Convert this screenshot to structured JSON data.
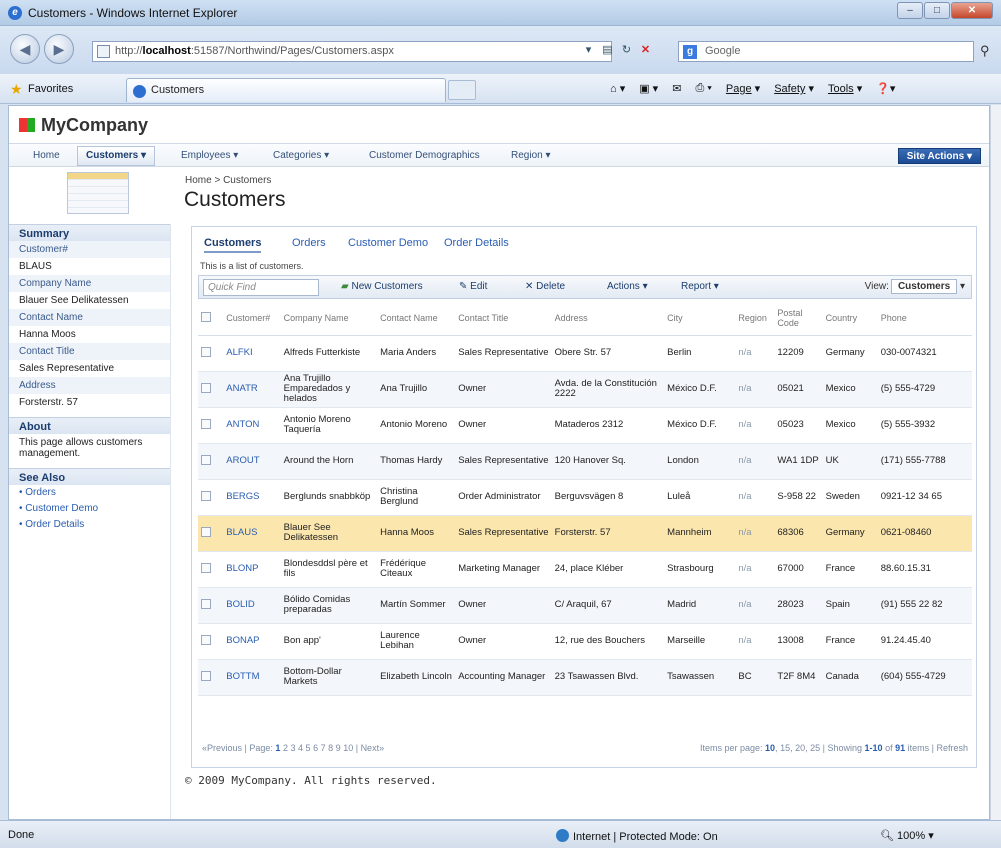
{
  "window": {
    "title": "Customers - Windows Internet Explorer"
  },
  "browser": {
    "url_prefix": "http://",
    "url_host": "localhost",
    "url_rest": ":51587/Northwind/Pages/Customers.aspx",
    "search_placeholder": "Google",
    "favorites_label": "Favorites",
    "tab_title": "Customers",
    "commands": {
      "page": "Page",
      "safety": "Safety",
      "tools": "Tools"
    }
  },
  "site": {
    "company": "MyCompany",
    "nav": [
      "Home",
      "Customers",
      "Employees",
      "Categories",
      "Customer Demographics",
      "Region"
    ],
    "site_actions": "Site Actions",
    "breadcrumb": "Home > Customers",
    "page_title": "Customers",
    "footer": "© 2009 MyCompany. All rights reserved."
  },
  "sidebar": {
    "summary_title": "Summary",
    "fields": [
      {
        "label": "Customer#",
        "value": "BLAUS"
      },
      {
        "label": "Company Name",
        "value": "Blauer See Delikatessen"
      },
      {
        "label": "Contact Name",
        "value": "Hanna Moos"
      },
      {
        "label": "Contact Title",
        "value": "Sales Representative"
      },
      {
        "label": "Address",
        "value": "Forsterstr. 57"
      }
    ],
    "about_title": "About",
    "about_text": "This page allows customers management.",
    "see_also_title": "See Also",
    "links": [
      "Orders",
      "Customer Demo",
      "Order Details"
    ]
  },
  "panel": {
    "tabs": [
      "Customers",
      "Orders",
      "Customer Demo",
      "Order Details"
    ],
    "description": "This is a list of customers.",
    "toolbar": {
      "quick_find": "Quick Find",
      "new": "New Customers",
      "edit": "Edit",
      "delete": "Delete",
      "actions": "Actions",
      "report": "Report",
      "view_label": "View:",
      "view_value": "Customers"
    },
    "columns": [
      "Customer#",
      "Company Name",
      "Contact Name",
      "Contact Title",
      "Address",
      "City",
      "Region",
      "Postal Code",
      "Country",
      "Phone"
    ],
    "rows": [
      [
        "ALFKI",
        "Alfreds Futterkiste",
        "Maria Anders",
        "Sales Representative",
        "Obere Str. 57",
        "Berlin",
        "n/a",
        "12209",
        "Germany",
        "030-0074321"
      ],
      [
        "ANATR",
        "Ana Trujillo Emparedados y helados",
        "Ana Trujillo",
        "Owner",
        "Avda. de la Constitución 2222",
        "México D.F.",
        "n/a",
        "05021",
        "Mexico",
        "(5) 555-4729"
      ],
      [
        "ANTON",
        "Antonio Moreno Taquería",
        "Antonio Moreno",
        "Owner",
        "Mataderos 2312",
        "México D.F.",
        "n/a",
        "05023",
        "Mexico",
        "(5) 555-3932"
      ],
      [
        "AROUT",
        "Around the Horn",
        "Thomas Hardy",
        "Sales Representative",
        "120 Hanover Sq.",
        "London",
        "n/a",
        "WA1 1DP",
        "UK",
        "(171) 555-7788"
      ],
      [
        "BERGS",
        "Berglunds snabbköp",
        "Christina Berglund",
        "Order Administrator",
        "Berguvsvägen 8",
        "Luleå",
        "n/a",
        "S-958 22",
        "Sweden",
        "0921-12 34 65"
      ],
      [
        "BLAUS",
        "Blauer See Delikatessen",
        "Hanna Moos",
        "Sales Representative",
        "Forsterstr. 57",
        "Mannheim",
        "n/a",
        "68306",
        "Germany",
        "0621-08460"
      ],
      [
        "BLONP",
        "Blondesddsl père et fils",
        "Frédérique Citeaux",
        "Marketing Manager",
        "24, place Kléber",
        "Strasbourg",
        "n/a",
        "67000",
        "France",
        "88.60.15.31"
      ],
      [
        "BOLID",
        "Bólido Comidas preparadas",
        "Martín Sommer",
        "Owner",
        "C/ Araquil, 67",
        "Madrid",
        "n/a",
        "28023",
        "Spain",
        "(91) 555 22 82"
      ],
      [
        "BONAP",
        "Bon app'",
        "Laurence Lebihan",
        "Owner",
        "12, rue des Bouchers",
        "Marseille",
        "n/a",
        "13008",
        "France",
        "91.24.45.40"
      ],
      [
        "BOTTM",
        "Bottom-Dollar Markets",
        "Elizabeth Lincoln",
        "Accounting Manager",
        "23 Tsawassen Blvd.",
        "Tsawassen",
        "BC",
        "T2F 8M4",
        "Canada",
        "(604) 555-4729"
      ]
    ],
    "pager": {
      "previous": "«Previous",
      "page_label": "Page:",
      "pages": [
        "1",
        "2",
        "3",
        "4",
        "5",
        "6",
        "7",
        "8",
        "9",
        "10"
      ],
      "next": "Next»",
      "per_page_label": "Items per page:",
      "per_page": [
        "10",
        "15",
        "20",
        "25"
      ],
      "showing": "Showing",
      "range": "1-10",
      "of": "of",
      "total": "91",
      "items": "items",
      "refresh": "Refresh"
    }
  },
  "status": {
    "left": "Done",
    "zone": "Internet | Protected Mode: On",
    "zoom": "100%"
  }
}
